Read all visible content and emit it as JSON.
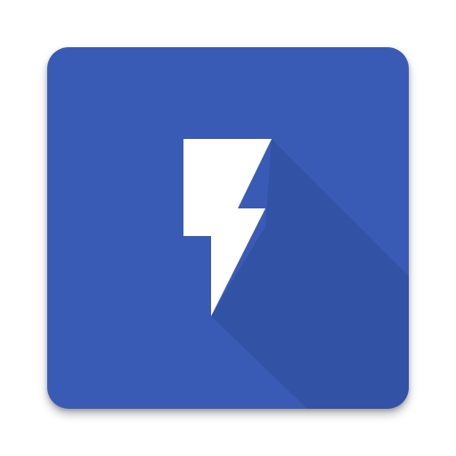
{
  "icon": {
    "name": "lightning-bolt-icon",
    "background_color": "#3A5BB5",
    "long_shadow_color": "#2A4A98",
    "bolt_color": "#FFFFFF"
  }
}
